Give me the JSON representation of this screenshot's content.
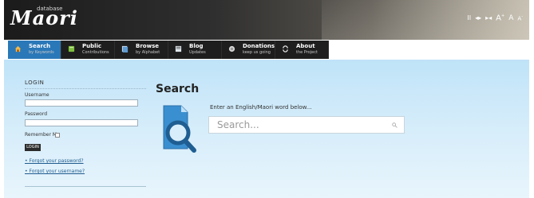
{
  "header": {
    "logo_main": "Maori",
    "logo_sub": "database",
    "controls": [
      "II",
      "◂▸",
      "▸◂",
      "A",
      "A",
      "A"
    ]
  },
  "nav": {
    "items": [
      {
        "label": "Search",
        "sub": "by Keywords",
        "icon": "home-icon",
        "active": true
      },
      {
        "label": "Public",
        "sub": "Contributions",
        "icon": "book-icon",
        "active": false
      },
      {
        "label": "Browse",
        "sub": "by Alphabet",
        "icon": "list-icon",
        "active": false
      },
      {
        "label": "Blog",
        "sub": "Updates",
        "icon": "blog-icon",
        "active": false
      },
      {
        "label": "Donations",
        "sub": "keep us going",
        "icon": "donation-icon",
        "active": false
      },
      {
        "label": "About",
        "sub": "the Project",
        "icon": "about-icon",
        "active": false
      }
    ],
    "active_color": "#2a78b8"
  },
  "login": {
    "title": "LOGIN",
    "username_label": "Username",
    "password_label": "Password",
    "remember_label": "Remember Me",
    "button_label": "LOGIN",
    "forgot_password": "Forgot your password?",
    "forgot_username": "Forgot your username?"
  },
  "search": {
    "heading": "Search",
    "prompt": "Enter an English/Maori word below...",
    "placeholder": "Search..."
  }
}
